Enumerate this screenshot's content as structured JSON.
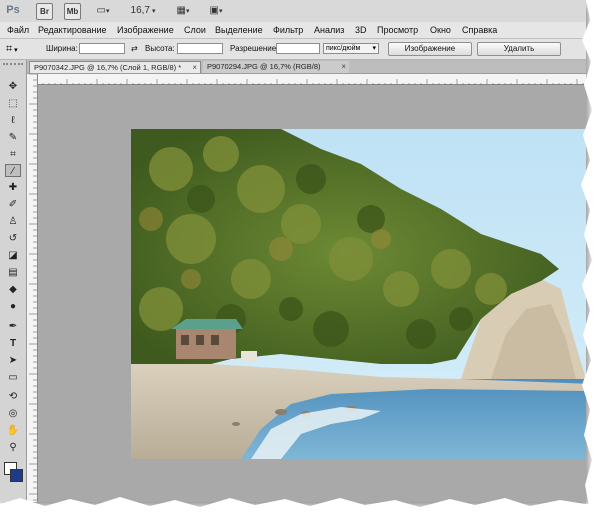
{
  "appbar": {
    "logo": "Ps",
    "br_label": "Br",
    "mb_label": "Mb",
    "zoom": "16,7"
  },
  "menu": [
    "Файл",
    "Редактирование",
    "Изображение",
    "Слои",
    "Выделение",
    "Фильтр",
    "Анализ",
    "3D",
    "Просмотр",
    "Окно",
    "Справка"
  ],
  "options": {
    "width_label": "Ширина:",
    "height_label": "Высота:",
    "resolution_label": "Разрешение:",
    "unit": "пикс/дюйм",
    "image_button": "Изображение",
    "delete_button": "Удалить"
  },
  "tabs": [
    {
      "label": "P9070342.JPG @ 16,7% (Слой 1, RGB/8) *",
      "close": "×"
    },
    {
      "label": "P9070294.JPG @ 16,7% (RGB/8)",
      "close": "×"
    }
  ],
  "colors": {
    "sky": "#c7e6f6",
    "forest": "#4f6a26",
    "sea": "#5f9ec6",
    "canvas_bg": "#a9a9a9"
  },
  "icons": {
    "tools": [
      "move-tool-icon",
      "marquee-tool-icon",
      "lasso-tool-icon",
      "quick-select-icon",
      "crop-tool-icon",
      "eyedropper-icon",
      "healing-brush-icon",
      "brush-tool-icon",
      "clone-stamp-icon",
      "history-brush-icon",
      "eraser-icon",
      "gradient-tool-icon",
      "blur-tool-icon",
      "dodge-tool-icon",
      "pen-tool-icon",
      "type-tool-icon",
      "path-select-icon",
      "shape-tool-icon",
      "3d-rotate-icon",
      "3d-camera-icon",
      "hand-tool-icon",
      "zoom-tool-icon"
    ]
  }
}
